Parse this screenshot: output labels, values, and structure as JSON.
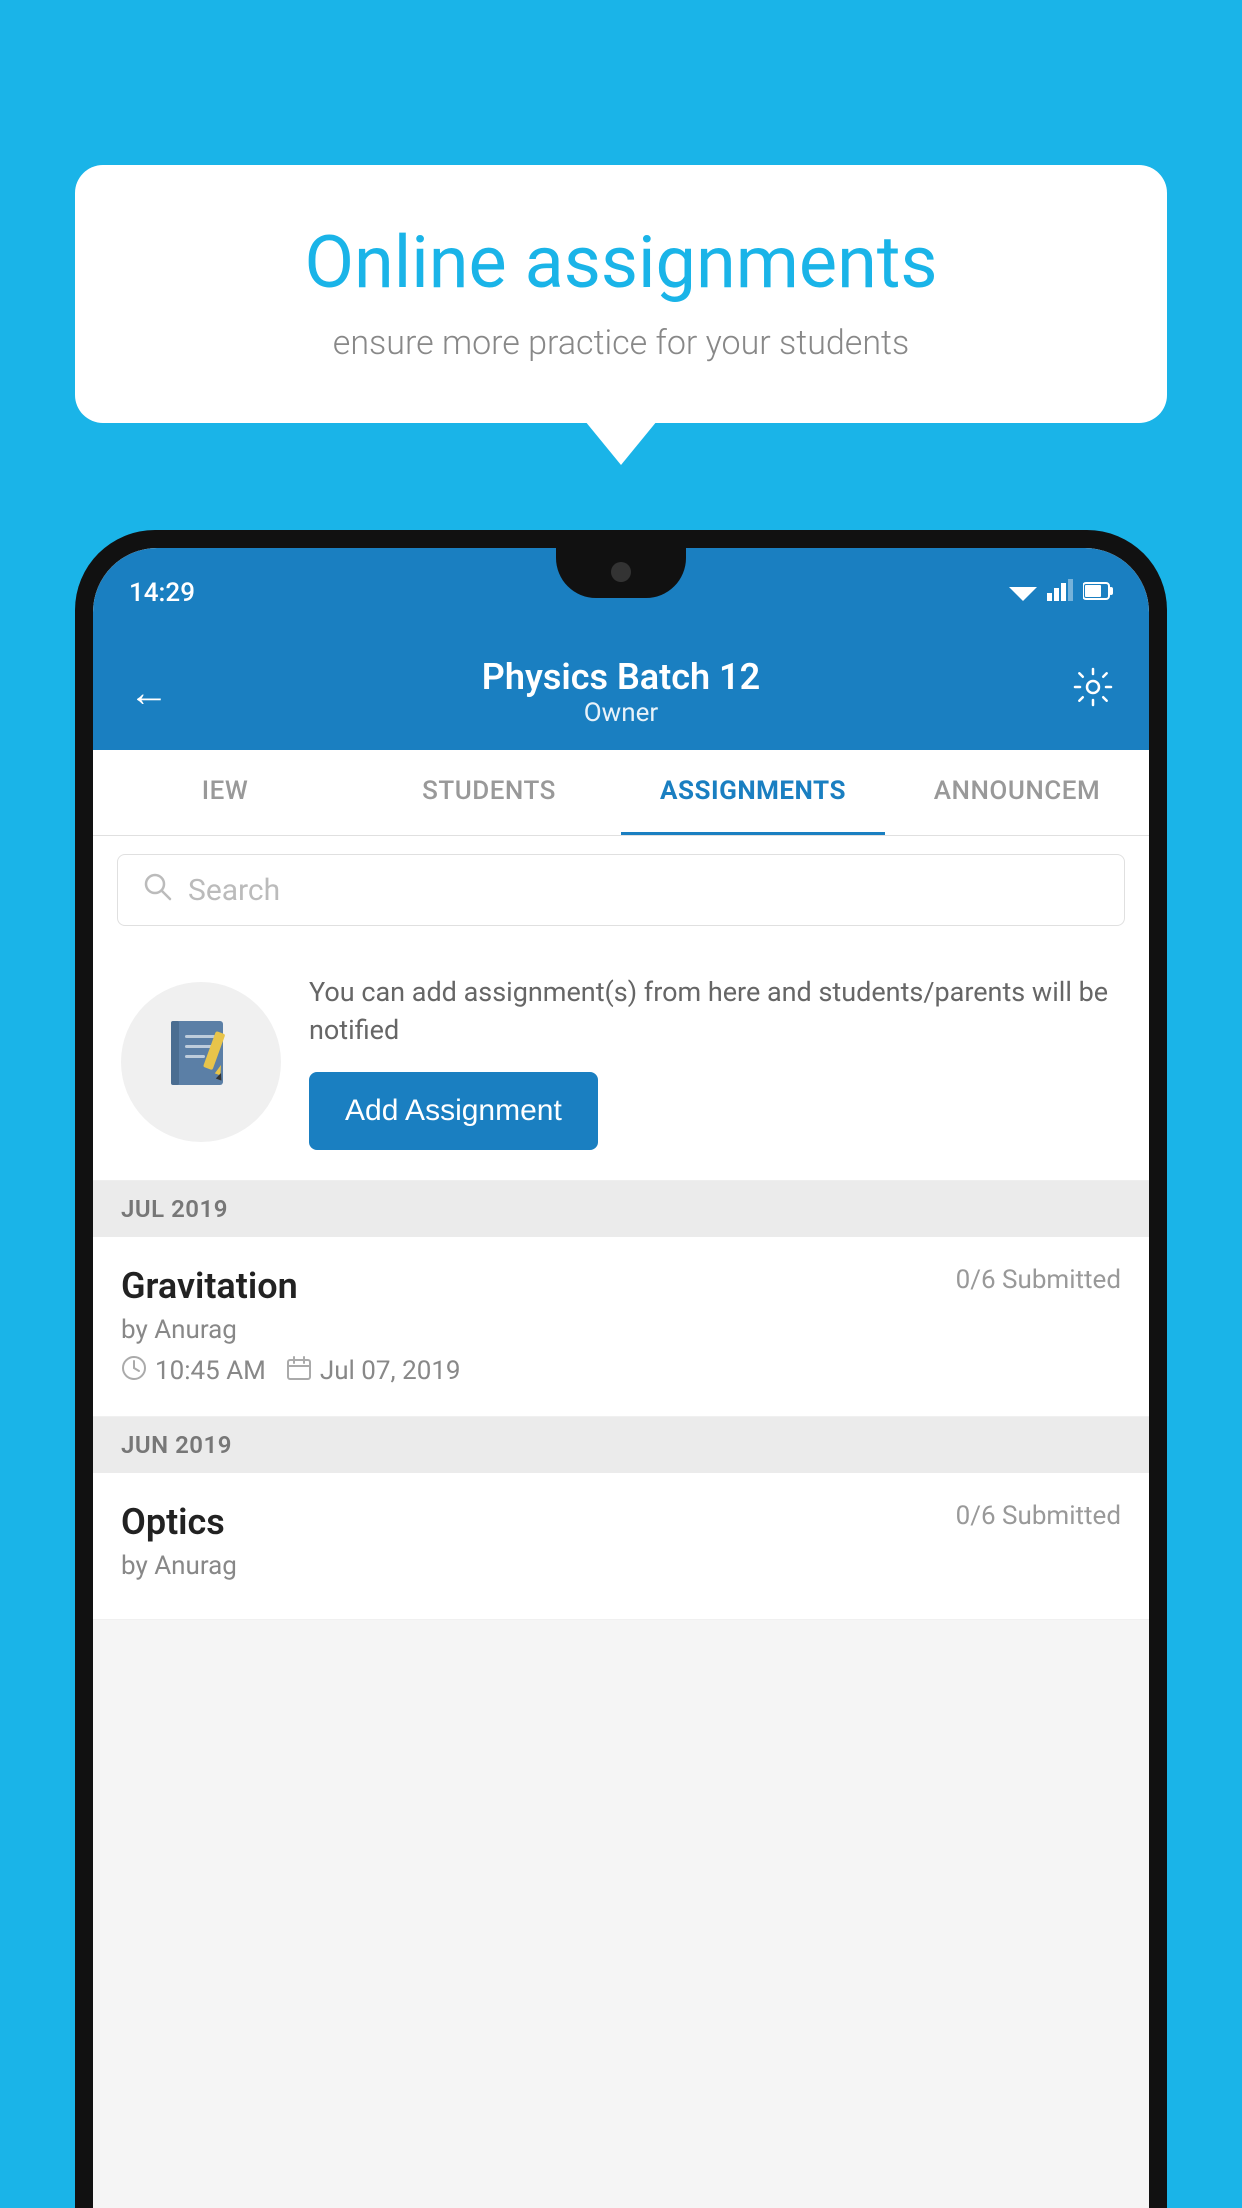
{
  "background_color": "#1ab4e8",
  "speech_bubble": {
    "title": "Online assignments",
    "subtitle": "ensure more practice for your students"
  },
  "phone": {
    "status_bar": {
      "time": "14:29",
      "wifi": "▼",
      "signal": "▲",
      "battery": "▮"
    },
    "header": {
      "title": "Physics Batch 12",
      "subtitle": "Owner",
      "back_label": "←",
      "settings_label": "⚙"
    },
    "tabs": [
      {
        "label": "IEW",
        "active": false
      },
      {
        "label": "STUDENTS",
        "active": false
      },
      {
        "label": "ASSIGNMENTS",
        "active": true
      },
      {
        "label": "ANNOUNCEM",
        "active": false
      }
    ],
    "search": {
      "placeholder": "Search"
    },
    "add_assignment": {
      "description": "You can add assignment(s) from here and students/parents will be notified",
      "button_label": "Add Assignment"
    },
    "sections": [
      {
        "month_label": "JUL 2019",
        "assignments": [
          {
            "name": "Gravitation",
            "submitted": "0/6 Submitted",
            "by": "by Anurag",
            "time": "10:45 AM",
            "date": "Jul 07, 2019"
          }
        ]
      },
      {
        "month_label": "JUN 2019",
        "assignments": [
          {
            "name": "Optics",
            "submitted": "0/6 Submitted",
            "by": "by Anurag",
            "time": "",
            "date": ""
          }
        ]
      }
    ]
  }
}
